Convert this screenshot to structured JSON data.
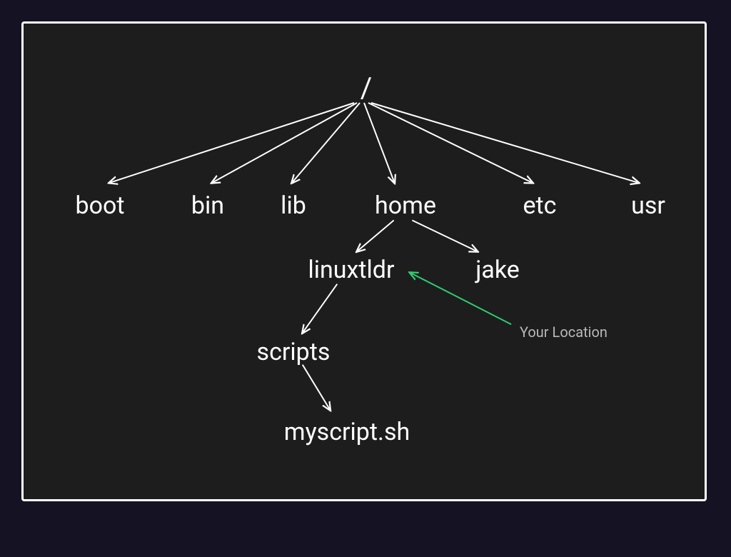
{
  "tree": {
    "root": "/",
    "level1": {
      "boot": "boot",
      "bin": "bin",
      "lib": "lib",
      "home": "home",
      "etc": "etc",
      "usr": "usr"
    },
    "home_children": {
      "linuxtldr": "linuxtldr",
      "jake": "jake"
    },
    "linuxtldr_children": {
      "scripts": "scripts"
    },
    "scripts_children": {
      "myscript": "myscript.sh"
    }
  },
  "annotation": {
    "your_location": "Your Location"
  },
  "colors": {
    "arrow": "#ffffff",
    "highlight": "#2ecc71"
  }
}
